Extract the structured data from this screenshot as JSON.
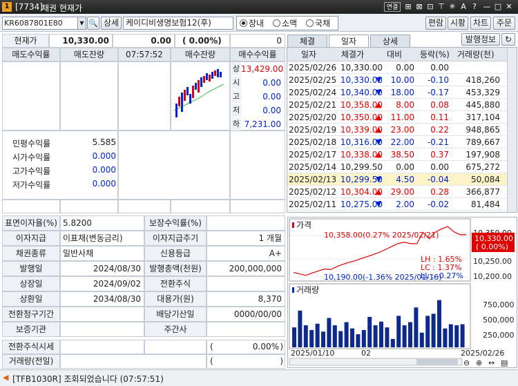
{
  "window": {
    "number": "1",
    "code": "[7734]",
    "title": "채권 현재가",
    "buttons": [
      "연결",
      "⊞",
      "⊠",
      "⊡",
      "⊤",
      "✳",
      "A",
      "?",
      "—",
      "□",
      "✕"
    ]
  },
  "toolbar": {
    "code_value": "KR6087801E80",
    "detail_label": "상세",
    "name_value": "케이디비생명보험12(후)",
    "radio_options": [
      "장내",
      "소액",
      "국채"
    ],
    "radio_selected": 0,
    "right_buttons": [
      "편람",
      "시황",
      "차트",
      "주문"
    ]
  },
  "quote": {
    "label": "현재가",
    "price": "10,330.00",
    "change": "0.00",
    "rate": "( 0.00%)",
    "volume": "0"
  },
  "orderbook": {
    "headers": [
      "매도수익률",
      "매도잔량",
      "07:57:52",
      "매수잔량",
      "매수수익률"
    ],
    "side_labels": [
      "상",
      "시",
      "고",
      "저",
      "하"
    ],
    "side_values": [
      "13,429.00",
      "0.00",
      "0.00",
      "0.00",
      "7,231.00"
    ]
  },
  "yields": {
    "rows": [
      {
        "label": "민평수익률",
        "value": "5.585"
      },
      {
        "label": "시가수익률",
        "value": "0.000"
      },
      {
        "label": "고가수익률",
        "value": "0.000"
      },
      {
        "label": "저가수익률",
        "value": "0.000"
      }
    ]
  },
  "info": {
    "rows": [
      {
        "l1": "표면이자율(%)",
        "v1": "5.8200",
        "l2": "보장수익률(%)",
        "v2": ""
      },
      {
        "l1": "이자지급",
        "v1": "이표채(변동금리)",
        "l2": "이자지급주기",
        "v2": "1 개월"
      },
      {
        "l1": "채권종류",
        "v1": "일반사채",
        "l2": "신용등급",
        "v2": "A+"
      },
      {
        "l1": "발행일",
        "v1": "2024/08/30",
        "l2": "발행총액(천원)",
        "v2": "200,000,000"
      },
      {
        "l1": "상장일",
        "v1": "2024/09/02",
        "l2": "전환주식",
        "v2": ""
      },
      {
        "l1": "상환일",
        "v1": "2034/08/30",
        "l2": "대용가(원)",
        "v2": "8,370"
      },
      {
        "l1": "전환청구기간",
        "v1": "",
        "l2": "배당기산일",
        "v2": "0000/00/00"
      },
      {
        "l1": "보증기관",
        "v1": "",
        "l2": "주간사",
        "v2": ""
      }
    ],
    "conv_label": "전환주식시세",
    "conv_value": "0.00%",
    "vol_label": "거래량(전일)",
    "paren_open": "(",
    "paren_close": ")"
  },
  "tabs": {
    "items": [
      "체결",
      "일자",
      "상세"
    ],
    "active": 1,
    "issue_info": "발행정보"
  },
  "daily": {
    "headers": [
      "일자",
      "체결가",
      "대비",
      "등락(%)",
      "거래량(천)"
    ],
    "rows": [
      {
        "date": "2025/02/26",
        "price": "10,330.00",
        "arrow": "",
        "diff": "0.00",
        "rate": "0.00",
        "vol": "",
        "dir": "flat"
      },
      {
        "date": "2025/02/25",
        "price": "10,330.00",
        "arrow": "▼",
        "diff": "10.00",
        "rate": "-0.10",
        "vol": "418,260",
        "dir": "down"
      },
      {
        "date": "2025/02/24",
        "price": "10,340.00",
        "arrow": "▼",
        "diff": "18.00",
        "rate": "-0.17",
        "vol": "453,329",
        "dir": "down"
      },
      {
        "date": "2025/02/21",
        "price": "10,358.00",
        "arrow": "▲",
        "diff": "8.00",
        "rate": "0.08",
        "vol": "445,880",
        "dir": "up"
      },
      {
        "date": "2025/02/20",
        "price": "10,350.00",
        "arrow": "▲",
        "diff": "11.00",
        "rate": "0.11",
        "vol": "317,104",
        "dir": "up"
      },
      {
        "date": "2025/02/19",
        "price": "10,339.00",
        "arrow": "▲",
        "diff": "23.00",
        "rate": "0.22",
        "vol": "948,865",
        "dir": "up"
      },
      {
        "date": "2025/02/18",
        "price": "10,316.00",
        "arrow": "▼",
        "diff": "22.00",
        "rate": "-0.21",
        "vol": "789,667",
        "dir": "down"
      },
      {
        "date": "2025/02/17",
        "price": "10,338.00",
        "arrow": "▲",
        "diff": "38.50",
        "rate": "0.37",
        "vol": "197,908",
        "dir": "up"
      },
      {
        "date": "2025/02/14",
        "price": "10,299.50",
        "arrow": "",
        "diff": "0.00",
        "rate": "0.00",
        "vol": "675,272",
        "dir": "flat"
      },
      {
        "date": "2025/02/13",
        "price": "10,299.50",
        "arrow": "▼",
        "diff": "4.50",
        "rate": "-0.04",
        "vol": "50,084",
        "dir": "down"
      },
      {
        "date": "2025/02/12",
        "price": "10,304.00",
        "arrow": "▲",
        "diff": "29.00",
        "rate": "0.28",
        "vol": "366,877",
        "dir": "up"
      },
      {
        "date": "2025/02/11",
        "price": "10,275.00",
        "arrow": "▼",
        "diff": "2.00",
        "rate": "-0.02",
        "vol": "81,484",
        "dir": "down"
      }
    ]
  },
  "chart": {
    "price_title": "가격",
    "volume_title": "거래량",
    "max_label": "10,358.00(0.27% 2025/02/21)",
    "min_label": "10,190.00(-1.36% 2025/01/16)",
    "lh": "LH : 1.65%",
    "lc": "LC : 1.37%",
    "ll": "LL : -0.27%",
    "current_price": "10,330.00",
    "current_rate": "( 0.00%)",
    "price_ticks": [
      "10,350.00",
      "10,250.00",
      "10,200.00"
    ],
    "volume_ticks": [
      "750,000",
      "500,000",
      "250,000"
    ],
    "x_labels": [
      "2025/01/10",
      "02",
      "2025/02/26"
    ],
    "price_series": [
      10200,
      10195,
      10190,
      10198,
      10205,
      10212,
      10210,
      10220,
      10228,
      10235,
      10240,
      10248,
      10255,
      10262,
      10270,
      10280,
      10290,
      10300,
      10304,
      10299,
      10299,
      10338,
      10316,
      10339,
      10350,
      10358,
      10340,
      10330,
      10330
    ],
    "volume_series": [
      380,
      700,
      420,
      330,
      450,
      300,
      560,
      420,
      310,
      480,
      360,
      250,
      330,
      580,
      420,
      490,
      380,
      160,
      600,
      420,
      480,
      760,
      280,
      600,
      640,
      900,
      360,
      440,
      420,
      440
    ]
  },
  "status": {
    "text": "[TFB1030R] 조회되었습니다 (07:57:51)"
  }
}
